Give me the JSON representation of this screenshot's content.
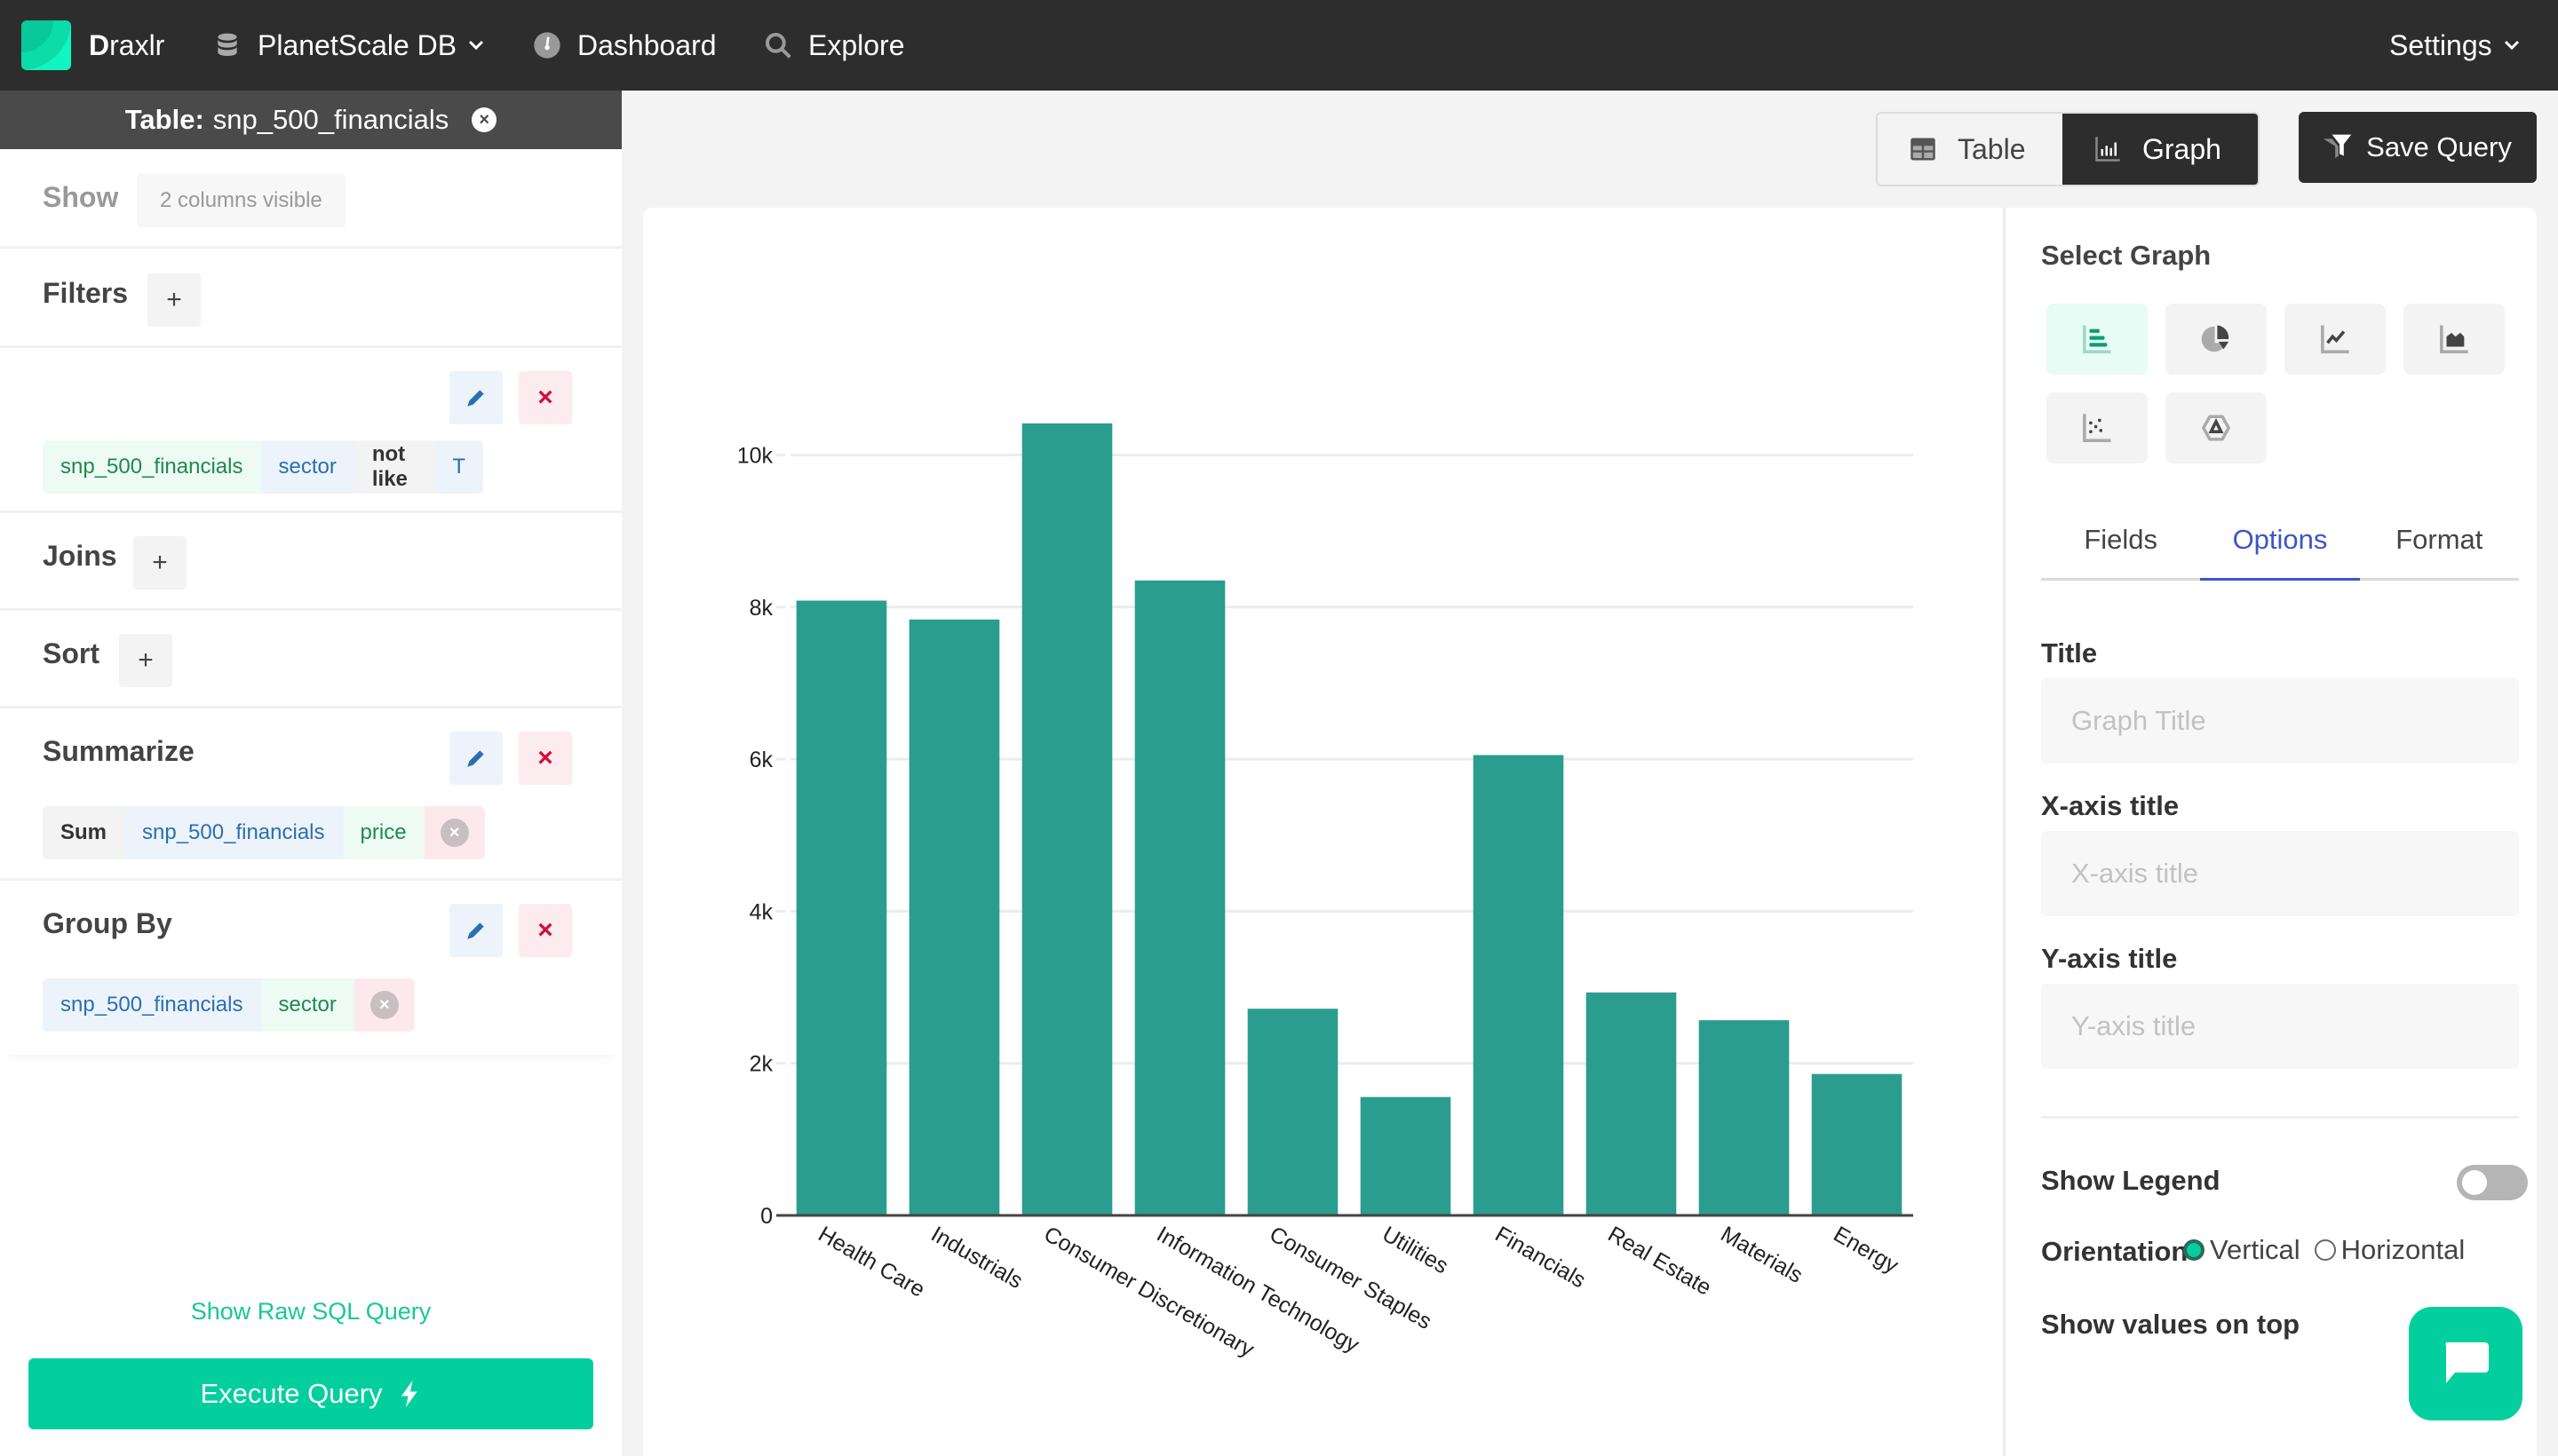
{
  "app": {
    "brand": "Draxlr",
    "brand_initial": "D",
    "brand_rest": "raxlr",
    "database": "PlanetScale DB",
    "nav": [
      "Dashboard",
      "Explore"
    ],
    "settings": "Settings"
  },
  "sidebar": {
    "table_label": "Table:",
    "table_name": "snp_500_financials",
    "show": {
      "label": "Show",
      "value": "2 columns visible"
    },
    "filters": {
      "label": "Filters",
      "add": "+",
      "items": [
        {
          "table": "snp_500_financials",
          "column": "sector",
          "operator": "not like",
          "value": "T"
        }
      ]
    },
    "joins": {
      "label": "Joins",
      "add": "+"
    },
    "sort": {
      "label": "Sort",
      "add": "+"
    },
    "summarize": {
      "label": "Summarize",
      "items": [
        {
          "func": "Sum",
          "table": "snp_500_financials",
          "column": "price"
        }
      ]
    },
    "group_by": {
      "label": "Group By",
      "items": [
        {
          "table": "snp_500_financials",
          "column": "sector"
        }
      ]
    },
    "raw_sql_link": "Show Raw SQL Query",
    "execute": "Execute Query"
  },
  "toolbar": {
    "views": [
      "Table",
      "Graph"
    ],
    "active_view": "Graph",
    "save": "Save Query"
  },
  "options": {
    "select_graph": "Select Graph",
    "graph_types": [
      "bar-chart",
      "pie-chart",
      "line-chart",
      "area-chart",
      "scatter-chart",
      "radar-chart"
    ],
    "active_graph": "bar-chart",
    "tabs": [
      "Fields",
      "Options",
      "Format"
    ],
    "active_tab": "Options",
    "title": {
      "label": "Title",
      "placeholder": "Graph Title",
      "value": ""
    },
    "x_axis": {
      "label": "X-axis title",
      "placeholder": "X-axis title",
      "value": ""
    },
    "y_axis": {
      "label": "Y-axis title",
      "placeholder": "Y-axis title",
      "value": ""
    },
    "show_legend": {
      "label": "Show Legend",
      "on": false
    },
    "orientation": {
      "label": "Orientation",
      "options": [
        "Vertical",
        "Horizontal"
      ],
      "selected": "Vertical"
    },
    "show_values": {
      "label": "Show values on top"
    }
  },
  "colors": {
    "accent": "#03cf9e",
    "bar": "#2a9d8f",
    "dark": "#2d2d2d",
    "tab_active": "#3c55c8"
  },
  "chart_data": {
    "type": "bar",
    "title": "",
    "xlabel": "",
    "ylabel": "",
    "categories": [
      "Health Care",
      "Industrials",
      "Consumer Discretionary",
      "Information Technology",
      "Consumer Staples",
      "Utilities",
      "Financials",
      "Real Estate",
      "Materials",
      "Energy"
    ],
    "values": [
      8085,
      7837,
      10416,
      8350,
      2718,
      1557,
      6054,
      2932,
      2567,
      1860
    ],
    "yticks": [
      0,
      2000,
      4000,
      6000,
      8000,
      10000
    ],
    "ytick_labels": [
      "0",
      "2k",
      "4k",
      "6k",
      "8k",
      "10k"
    ],
    "ylim": [
      0,
      10900
    ],
    "grid": true,
    "legend": "none"
  }
}
